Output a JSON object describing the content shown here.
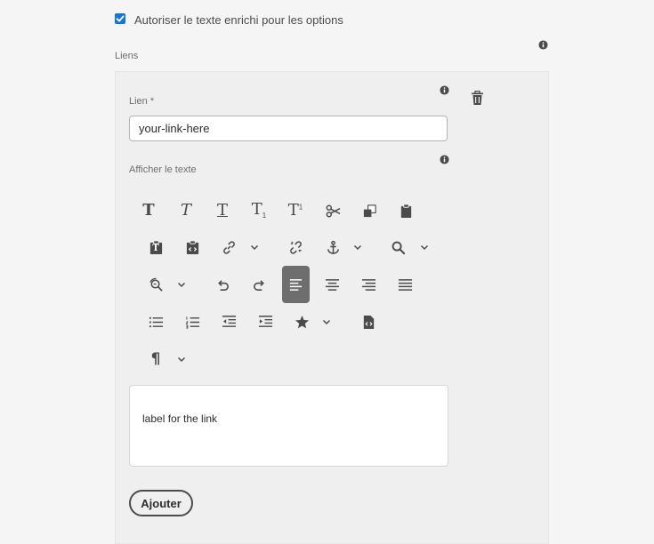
{
  "options": {
    "rich_text_label": "Autoriser le texte enrichi pour les options",
    "rich_text_checked": true
  },
  "links": {
    "section_label": "Liens",
    "link_field": {
      "label": "Lien *",
      "value": "your-link-here"
    },
    "display_text_label": "Afficher le texte",
    "editor_content": "label for the link",
    "add_button": "Ajouter"
  },
  "toolbar": {
    "subscript_mark": "1",
    "superscript_mark": "1",
    "paste_text_mark": "T",
    "bold_glyph": "T",
    "italic_glyph": "T",
    "underline_glyph": "T",
    "paragraph_glyph": "¶",
    "active_align": "align-left",
    "icons": [
      "bold-icon",
      "italic-icon",
      "underline-icon",
      "subscript-icon",
      "superscript-icon",
      "cut-icon",
      "copy-icon",
      "paste-icon",
      "paste-plain-text-icon",
      "paste-from-word-icon",
      "link-icon",
      "unlink-icon",
      "anchor-icon",
      "find-icon",
      "find-replace-icon",
      "undo-icon",
      "redo-icon",
      "align-left-icon",
      "align-center-icon",
      "align-right-icon",
      "align-justify-icon",
      "bullet-list-icon",
      "numbered-list-icon",
      "outdent-icon",
      "indent-icon",
      "special-char-icon",
      "source-edit-icon",
      "paragraph-format-icon"
    ]
  },
  "colors": {
    "accent": "#1473e6",
    "panel_bg": "#efefef",
    "page_bg": "#f5f5f5",
    "active_button": "#6e6e6e"
  }
}
